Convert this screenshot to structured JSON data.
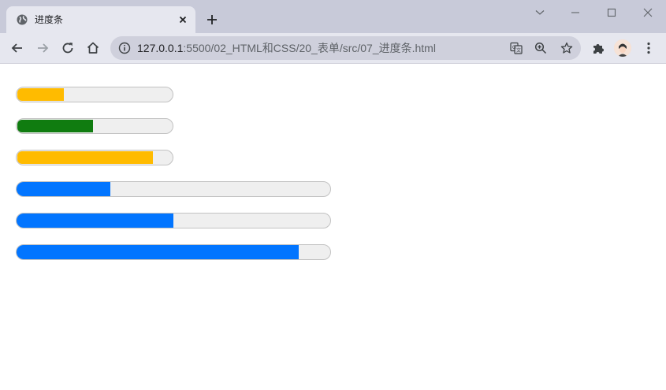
{
  "browser": {
    "tab": {
      "title": "进度条",
      "favicon": "globe-icon",
      "close_icon": "close-icon"
    },
    "new_tab_icon": "plus-icon",
    "window_controls": [
      "tab-search-chevron-icon",
      "minimize-icon",
      "maximize-icon",
      "close-window-icon"
    ],
    "toolbar": {
      "back_icon": "back-arrow-icon",
      "forward_icon": "forward-arrow-icon",
      "reload_icon": "reload-icon",
      "home_icon": "home-icon",
      "extensions_icon": "puzzle-icon",
      "menu_icon": "kebab-menu-icon"
    },
    "omnibox": {
      "info_icon": "info-icon",
      "url_host": "127.0.0.1",
      "url_rest": ":5500/02_HTML和CSS/20_表单/src/07_进度条.html",
      "icons": [
        "translate-icon",
        "zoom-icon",
        "star-icon"
      ]
    }
  },
  "page": {
    "progress_bars": [
      {
        "value": 0.3,
        "color": "#ffbb00"
      },
      {
        "value": 0.49,
        "color": "#107c10"
      },
      {
        "value": 0.88,
        "color": "#ffbb00"
      },
      {
        "value": 0.3,
        "color": "#0275ff"
      },
      {
        "value": 0.5,
        "color": "#0275ff"
      },
      {
        "value": 0.9,
        "color": "#0275ff"
      }
    ]
  },
  "colors": {
    "titlebar": "#c8cad9",
    "toolbar": "#e6e7ef",
    "track": "#efefef",
    "track_border": "#c2c2c2"
  }
}
